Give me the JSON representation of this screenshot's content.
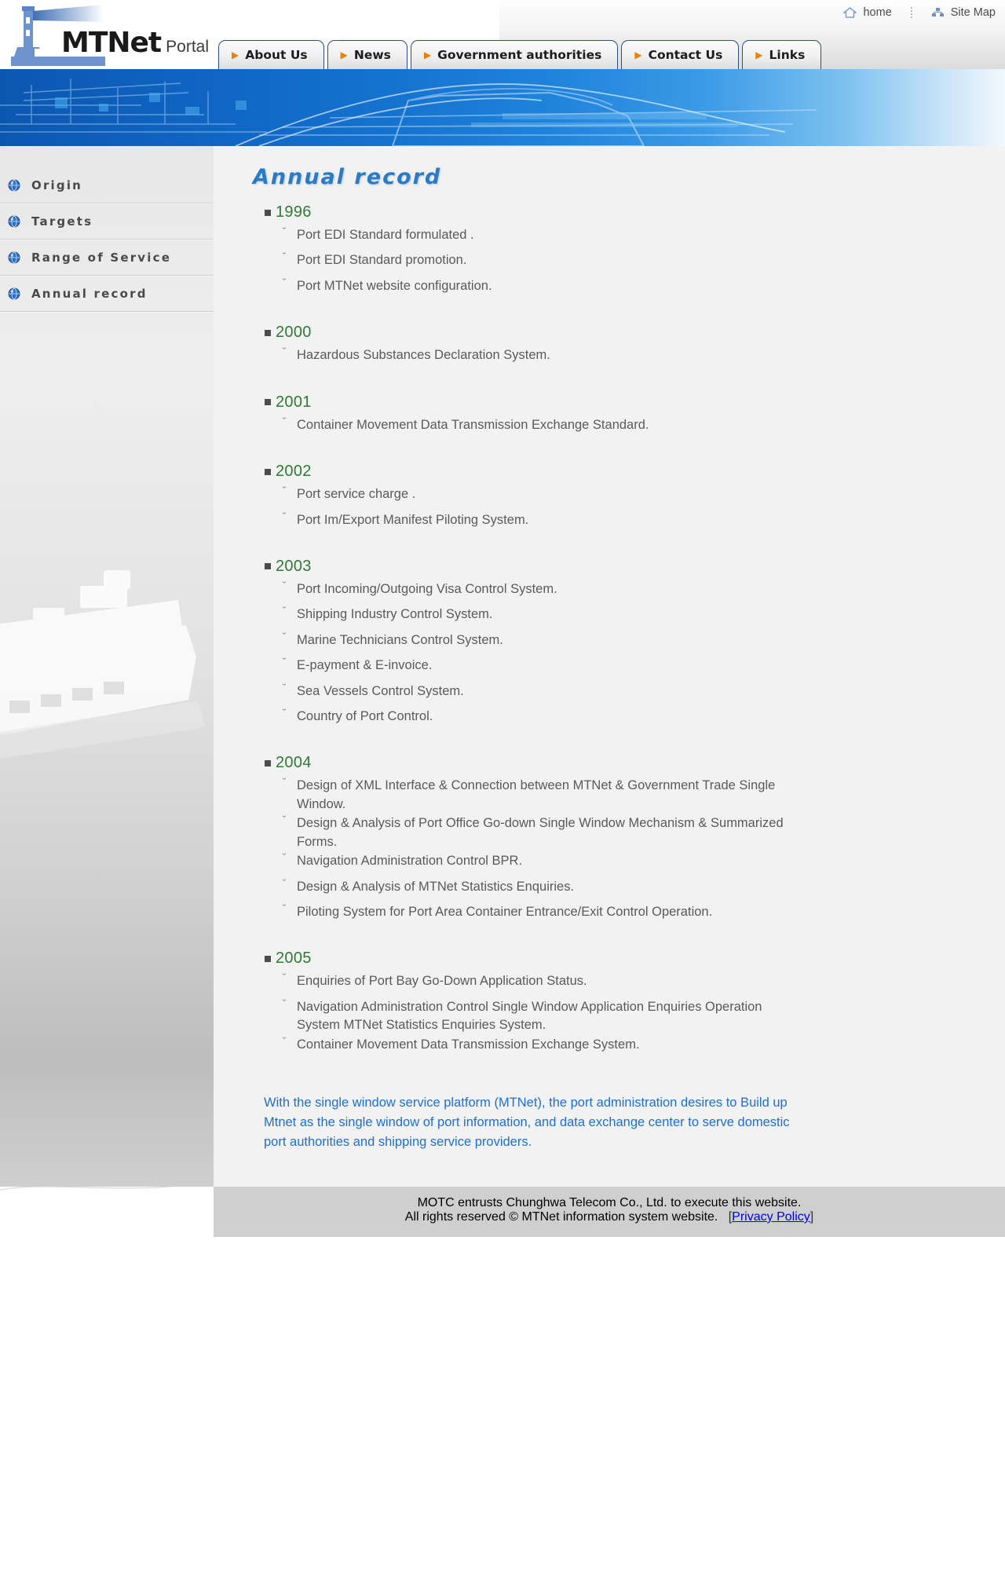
{
  "site": {
    "brand_main": "MTNet",
    "brand_sub": "Portal"
  },
  "utility": {
    "home_label": "home",
    "home_icon": "home-icon",
    "sitemap_label": "Site Map",
    "sitemap_icon": "sitemap-icon"
  },
  "nav": {
    "tabs": [
      {
        "label": "About Us",
        "icon": "arrow-right-icon"
      },
      {
        "label": "News",
        "icon": "arrow-right-icon"
      },
      {
        "label": "Government authorities",
        "icon": "arrow-right-icon"
      },
      {
        "label": "Contact Us",
        "icon": "arrow-right-icon"
      },
      {
        "label": "Links",
        "icon": "arrow-right-icon"
      }
    ]
  },
  "sidebar": {
    "items": [
      {
        "label": "Origin",
        "icon": "globe-icon"
      },
      {
        "label": "Targets",
        "icon": "globe-icon"
      },
      {
        "label": "Range of Service",
        "icon": "globe-icon"
      },
      {
        "label": "Annual record",
        "icon": "globe-icon"
      }
    ]
  },
  "main": {
    "title": "Annual record",
    "years": [
      {
        "year": "1996",
        "items": [
          "Port EDI Standard formulated .",
          "Port EDI Standard promotion.",
          "Port MTNet website configuration."
        ]
      },
      {
        "year": "2000",
        "items": [
          "Hazardous Substances Declaration System."
        ]
      },
      {
        "year": "2001",
        "items": [
          "Container Movement Data Transmission Exchange Standard."
        ]
      },
      {
        "year": "2002",
        "items": [
          "Port service charge .",
          "Port Im/Export Manifest Piloting System."
        ]
      },
      {
        "year": "2003",
        "items": [
          "Port Incoming/Outgoing Visa Control System.",
          "Shipping Industry Control System.",
          "Marine Technicians Control System.",
          "E-payment & E-invoice.",
          "Sea Vessels Control System.",
          "Country of Port Control."
        ]
      },
      {
        "year": "2004",
        "items": [
          "Design of XML Interface & Connection between MTNet & Government Trade Single Window.",
          "Design & Analysis of Port Office Go-down Single Window Mechanism & Summarized Forms.",
          "Navigation Administration Control BPR.",
          "Design & Analysis of MTNet Statistics Enquiries.",
          "Piloting System for Port Area Container Entrance/Exit Control Operation."
        ]
      },
      {
        "year": "2005",
        "items": [
          "Enquiries of Port Bay Go-Down Application Status.",
          "Navigation Administration Control Single Window Application Enquiries Operation System MTNet Statistics Enquiries System.",
          "Container Movement Data Transmission Exchange System."
        ]
      }
    ],
    "closing_paragraph": "With the single window service platform (MTNet), the port administration desires to Build up Mtnet as the single window of port information, and data exchange center to serve domestic port authorities and shipping service providers."
  },
  "footer": {
    "line1": "MOTC entrusts Chunghwa Telecom Co., Ltd. to execute this website.",
    "line2_prefix": "All rights reserved © MTNet information system website.",
    "privacy_open": "[",
    "privacy_label": "Privacy Policy",
    "privacy_close": "]"
  },
  "colors": {
    "accent_blue": "#2a7ac4",
    "year_green": "#2f7a36",
    "tab_border": "#2a4f87",
    "arrow_orange": "#e8820c",
    "link_blue": "#1f6fd0"
  }
}
